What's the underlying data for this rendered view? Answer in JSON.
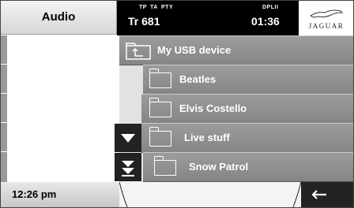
{
  "header": {
    "title": "Audio",
    "indicators": {
      "tp": "TP",
      "ta": "TA",
      "pty": "PTY",
      "dpl": "DPLII"
    },
    "track": "Tr 681",
    "clock": "01:36",
    "brand": "JAGUAR"
  },
  "browser": {
    "current_folder": "My USB device",
    "items": [
      {
        "label": "Beatles",
        "icon": "folder-icon"
      },
      {
        "label": "Elvis Costello",
        "icon": "folder-icon"
      },
      {
        "label": "Live stuff",
        "icon": "folder-icon"
      },
      {
        "label": "Snow Patrol",
        "icon": "folder-icon"
      }
    ],
    "controls": {
      "scroll_down": "chevron-down-icon",
      "page_down": "double-chevron-down-icon"
    }
  },
  "footer": {
    "time": "12:26 pm",
    "back_icon": "back-arrow-icon"
  }
}
